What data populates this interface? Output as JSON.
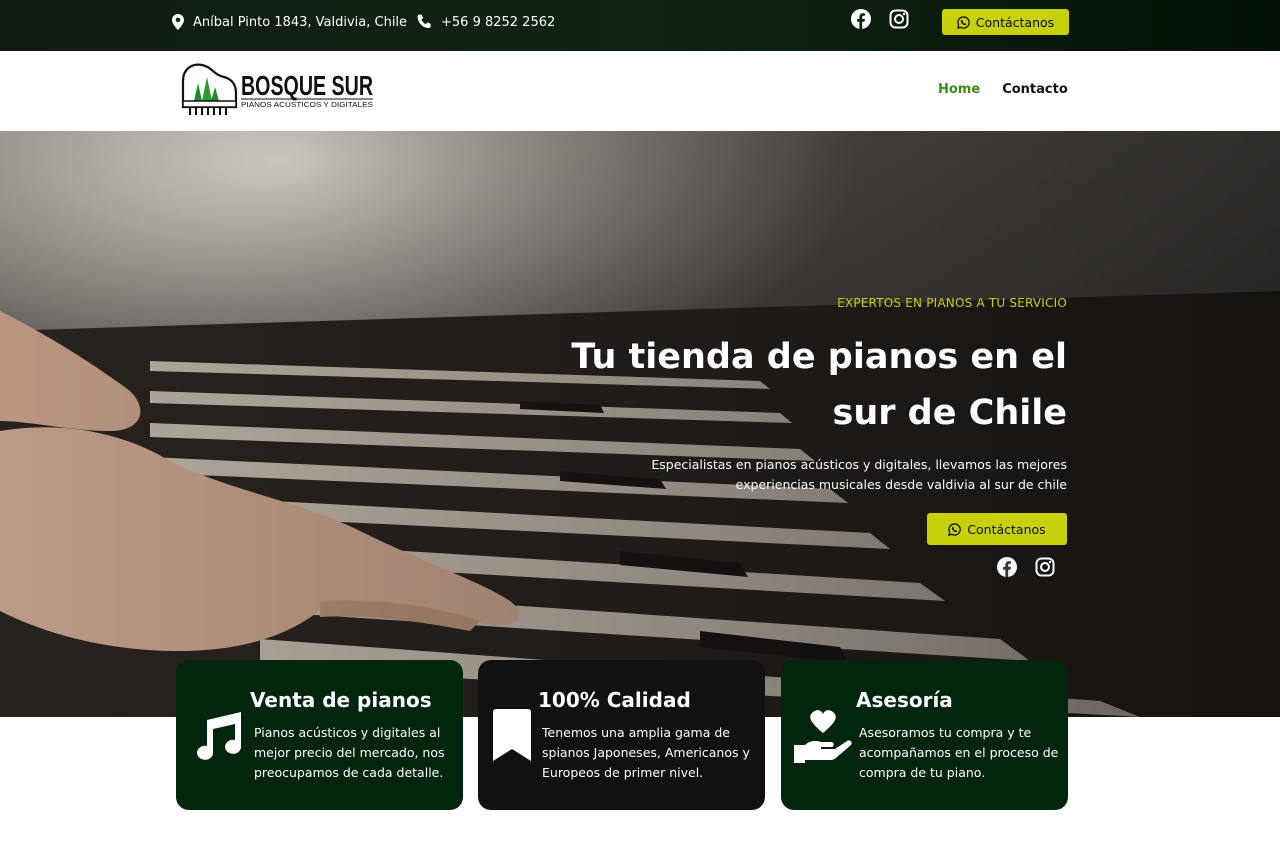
{
  "topbar": {
    "address": "Aníbal Pinto 1843, Valdivia, Chile",
    "phone": "+56 9 8252 2562",
    "contact_label": "Contáctanos"
  },
  "logo": {
    "brand": "BOSQUE SUR",
    "tagline": "PIANOS ACÚSTICOS Y DIGITALES"
  },
  "nav": {
    "items": [
      {
        "label": "Home"
      },
      {
        "label": "Contacto"
      }
    ]
  },
  "hero": {
    "tagline": "EXPERTOS EN PIANOS A TU SERVICIO",
    "title": "Tu tienda de pianos en el sur de Chile",
    "description": "Especialistas en pianos acústicos y digitales, llevamos las mejores experiencias musicales desde valdivia al sur de chile",
    "cta_label": "Contáctanos"
  },
  "cards": [
    {
      "title": "Venta de pianos",
      "text": "Pianos acústicos y digitales al mejor precio del mercado, nos preocupamos de cada detalle.",
      "icon": "music-note-icon"
    },
    {
      "title": "100% Calidad",
      "text": "Tenemos una amplia gama de spianos Japoneses,  Americanos y Europeos de primer nivel.",
      "icon": "bookmark-icon"
    },
    {
      "title": "Asesoría",
      "text": "Asesoramos tu compra y te acompañamos en el proceso de compra de tu piano.",
      "icon": "hand-heart-icon"
    }
  ],
  "colors": {
    "accent": "#c6d10c",
    "nav_active": "#3d8a15",
    "card_green": "#02260d",
    "card_dark": "#111111"
  }
}
